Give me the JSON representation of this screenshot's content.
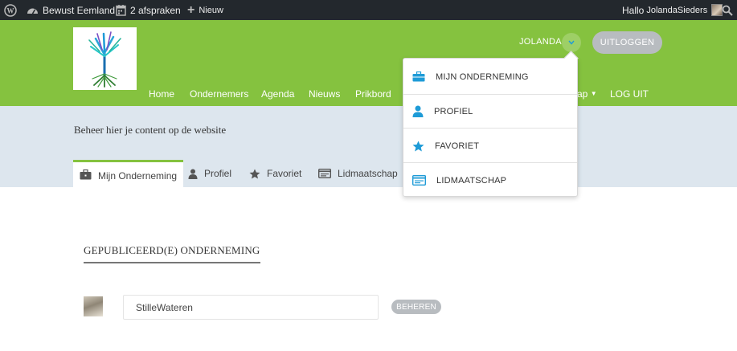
{
  "admin_bar": {
    "site_name": "Bewust Eemland",
    "appointments": "2 afspraken",
    "new_label": "Nieuw",
    "greeting": "Hallo",
    "username": "JolandaSieders"
  },
  "header": {
    "nav": [
      "Home",
      "Ondernemers",
      "Agenda",
      "Nieuws",
      "Prikbord",
      "ap",
      "LOG UIT"
    ],
    "user_display_name": "JOLANDA",
    "logout_button": "UITLOGGEN"
  },
  "user_menu": {
    "items": [
      {
        "label": "MIJN ONDERNEMING",
        "icon": "briefcase-icon"
      },
      {
        "label": "PROFIEL",
        "icon": "user-icon"
      },
      {
        "label": "FAVORIET",
        "icon": "star-icon"
      },
      {
        "label": "LIDMAATSCHAP",
        "icon": "membership-card-icon"
      }
    ]
  },
  "subheader": {
    "intro": "Beheer hier je content op de website",
    "tabs": [
      {
        "label": "Mijn Onderneming",
        "icon": "briefcase-icon",
        "active": true
      },
      {
        "label": "Profiel",
        "icon": "user-icon",
        "active": false
      },
      {
        "label": "Favoriet",
        "icon": "star-icon",
        "active": false
      },
      {
        "label": "Lidmaatschap",
        "icon": "membership-card-icon",
        "active": false
      }
    ]
  },
  "content": {
    "section_title": "GEPUBLICEERD(E) ONDERNEMING",
    "business": {
      "name": "StilleWateren",
      "action": "BEHEREN"
    }
  },
  "colors": {
    "accent_green": "#85c23f",
    "icon_blue": "#1e9bd7",
    "admin_bar": "#23282d",
    "band": "#dde6ee",
    "pill_gray": "#b8bcc0"
  }
}
